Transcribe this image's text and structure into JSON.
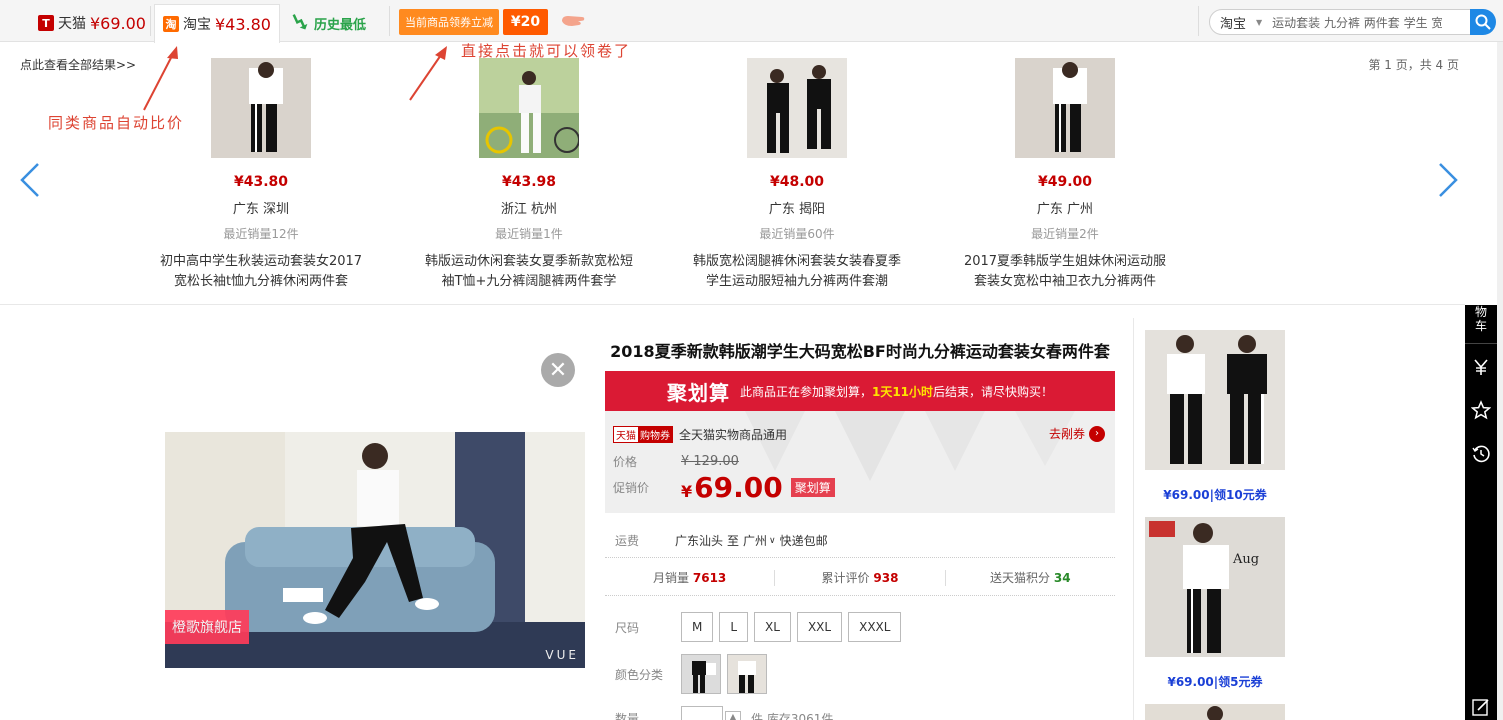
{
  "topbar": {
    "tabs": [
      {
        "logo": "T",
        "label": "天猫",
        "price": "¥69.00"
      },
      {
        "logo": "淘",
        "label": "淘宝",
        "price": "¥43.80"
      },
      {
        "label": "历史最低"
      }
    ],
    "coupon_label": "当前商品领券立减",
    "coupon_amount": "¥20",
    "search": {
      "scope": "淘宝",
      "value": "运动套装 九分裤 两件套 学生 宽"
    }
  },
  "compare": {
    "see_all": "点此查看全部结果>>",
    "pager": "第 1 页，共 4 页",
    "annotation_compare": "同类商品自动比价",
    "annotation_coupon": "直接点击就可以领卷了",
    "items": [
      {
        "price": "¥43.80",
        "location": "广东 深圳",
        "sales": "最近销量12件",
        "title": "初中高中学生秋装运动套装女2017宽松长袖t恤九分裤休闲两件套"
      },
      {
        "price": "¥43.98",
        "location": "浙江 杭州",
        "sales": "最近销量1件",
        "title": "韩版运动休闲套装女夏季新款宽松短袖T恤+九分裤阔腿裤两件套学"
      },
      {
        "price": "¥48.00",
        "location": "广东 揭阳",
        "sales": "最近销量60件",
        "title": "韩版宽松阔腿裤休闲套装女装春夏季学生运动服短袖九分裤两件套潮"
      },
      {
        "price": "¥49.00",
        "location": "广东 广州",
        "sales": "最近销量2件",
        "title": "2017夏季韩版学生姐妹休闲运动服套装女宽松中袖卫衣九分裤两件"
      }
    ]
  },
  "product": {
    "title": "2018夏季新款韩版潮学生大码宽松BF时尚九分裤运动套装女春两件套",
    "store_tag": "橙歌旗舰店",
    "image_watermark": "VUE",
    "juhuasuan": {
      "logo": "聚划算",
      "text_before": "此商品正在参加聚划算，",
      "time": "1天11小时",
      "text_after": "后结束，请尽快购买！"
    },
    "coupon_badge_a": "天猫",
    "coupon_badge_b": "购物券",
    "coupon_text": "全天猫实物商品通用",
    "get_coupon": "去剐券",
    "price_label": "价格",
    "original_price": "¥ 129.00",
    "promo_label": "促销价",
    "promo_yen": "¥",
    "promo_price": "69.00",
    "promo_tag": "聚划算",
    "shipping": {
      "label": "运费",
      "from": "广东汕头",
      "to_word": "至",
      "to": "广州",
      "method": "快递包邮"
    },
    "stats": {
      "monthly_label": "月销量",
      "monthly": "7613",
      "reviews_label": "累计评价",
      "reviews": "938",
      "points_label": "送天猫积分",
      "points": "34"
    },
    "size_label": "尺码",
    "sizes": [
      "M",
      "L",
      "XL",
      "XXL",
      "XXXL"
    ],
    "color_label": "颜色分类",
    "qty_label": "数量",
    "stock_text": "件    库存3061件"
  },
  "recommendations": [
    {
      "price": "¥69.00",
      "coupon": "领10元券"
    },
    {
      "price": "¥69.00",
      "coupon": "领5元券"
    }
  ],
  "sidebar": {
    "cart_label": "物\n车"
  },
  "colors": {
    "price_red": "#c40000",
    "juhuasuan_red": "#da1a34",
    "accent_blue": "#1e88e5",
    "coupon_orange": "#ff8a1f"
  }
}
